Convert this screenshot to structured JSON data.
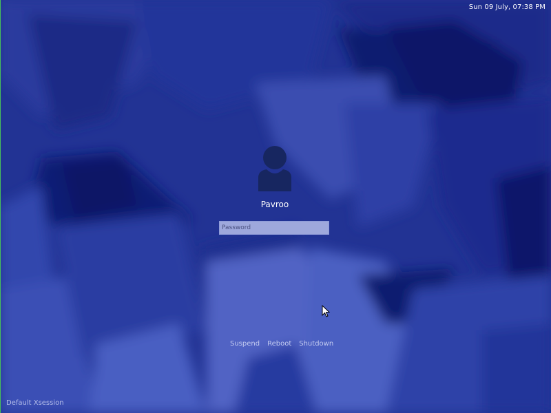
{
  "clock": {
    "text": "Sun 09 July,  07:38 PM"
  },
  "login": {
    "username": "Pavroo",
    "password_placeholder": "Password",
    "avatar_icon": "user-icon"
  },
  "power": {
    "suspend": "Suspend",
    "reboot": "Reboot",
    "shutdown": "Shutdown"
  },
  "session": {
    "label": "Default Xsession"
  },
  "colors": {
    "background": "#1f2f8c",
    "avatar": "#172660",
    "password_field": "#9ea8dc"
  }
}
